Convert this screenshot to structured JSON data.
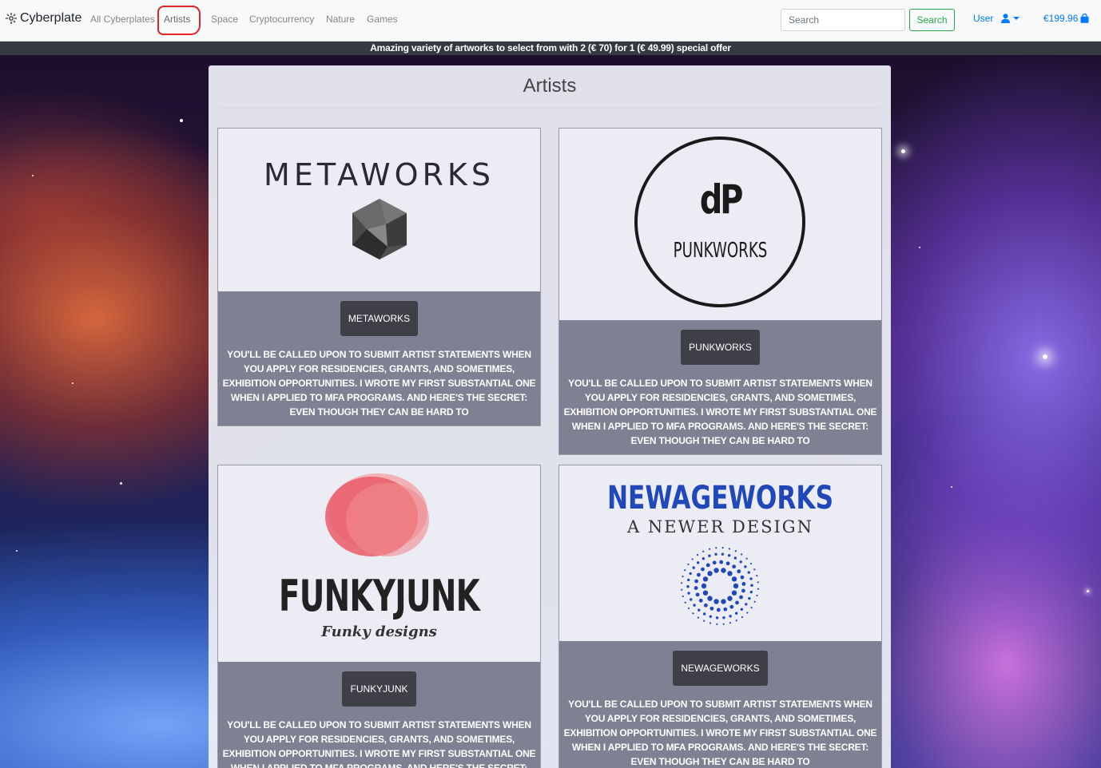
{
  "navbar": {
    "brand": "Cyberplate",
    "links": [
      "All Cyberplates",
      "Artists",
      "Space",
      "Cryptocurrency",
      "Nature",
      "Games"
    ],
    "active_link": "Artists",
    "search_placeholder": "Search",
    "search_button": "Search",
    "user_label": "User",
    "cart_total": "€199.96"
  },
  "promo": "Amazing variety of artworks to select from with 2 (€ 70) for 1 (€ 49.99) special offer",
  "page": {
    "title": "Artists"
  },
  "artists": [
    {
      "name": "METAWORKS",
      "logo_text": "METAWORKS",
      "button": "METAWORKS",
      "description": "YOU'LL BE CALLED UPON TO SUBMIT ARTIST STATEMENTS WHEN YOU APPLY FOR RESIDENCIES, GRANTS, AND SOMETIMES, EXHIBITION OPPORTUNITIES. I WROTE MY FIRST SUBSTANTIAL ONE WHEN I APPLIED TO MFA PROGRAMS. AND HERE'S THE SECRET: EVEN THOUGH THEY CAN BE HARD TO"
    },
    {
      "name": "PUNKWORKS",
      "logo_text": "PUNKWORKS",
      "logo_mark": "dP",
      "button": "PUNKWORKS",
      "description": "YOU'LL BE CALLED UPON TO SUBMIT ARTIST STATEMENTS WHEN YOU APPLY FOR RESIDENCIES, GRANTS, AND SOMETIMES, EXHIBITION OPPORTUNITIES. I WROTE MY FIRST SUBSTANTIAL ONE WHEN I APPLIED TO MFA PROGRAMS. AND HERE'S THE SECRET: EVEN THOUGH THEY CAN BE HARD TO"
    },
    {
      "name": "FUNKYJUNK",
      "logo_text": "FUNKYJUNK",
      "logo_sub": "Funky designs",
      "button": "FUNKYJUNK",
      "description": "YOU'LL BE CALLED UPON TO SUBMIT ARTIST STATEMENTS WHEN YOU APPLY FOR RESIDENCIES, GRANTS, AND SOMETIMES, EXHIBITION OPPORTUNITIES. I WROTE MY FIRST SUBSTANTIAL ONE WHEN I APPLIED TO MFA PROGRAMS. AND HERE'S THE SECRET: EVEN THOUGH THEY CAN BE HARD TO"
    },
    {
      "name": "NEWAGEWORKS",
      "logo_text": "NEWAGEWORKS",
      "logo_sub": "A NEWER DESIGN",
      "button": "NEWAGEWORKS",
      "description": "YOU'LL BE CALLED UPON TO SUBMIT ARTIST STATEMENTS WHEN YOU APPLY FOR RESIDENCIES, GRANTS, AND SOMETIMES, EXHIBITION OPPORTUNITIES. I WROTE MY FIRST SUBSTANTIAL ONE WHEN I APPLIED TO MFA PROGRAMS. AND HERE'S THE SECRET: EVEN THOUGH THEY CAN BE HARD TO"
    }
  ],
  "colors": {
    "accent": "#007bff",
    "search_green": "#28a745",
    "highlight_red": "#e32224",
    "newageworks_blue": "#2148b8"
  },
  "icons": {
    "brand": "brand-logo-icon",
    "user": "user-icon",
    "cart": "shopping-bag-icon"
  }
}
